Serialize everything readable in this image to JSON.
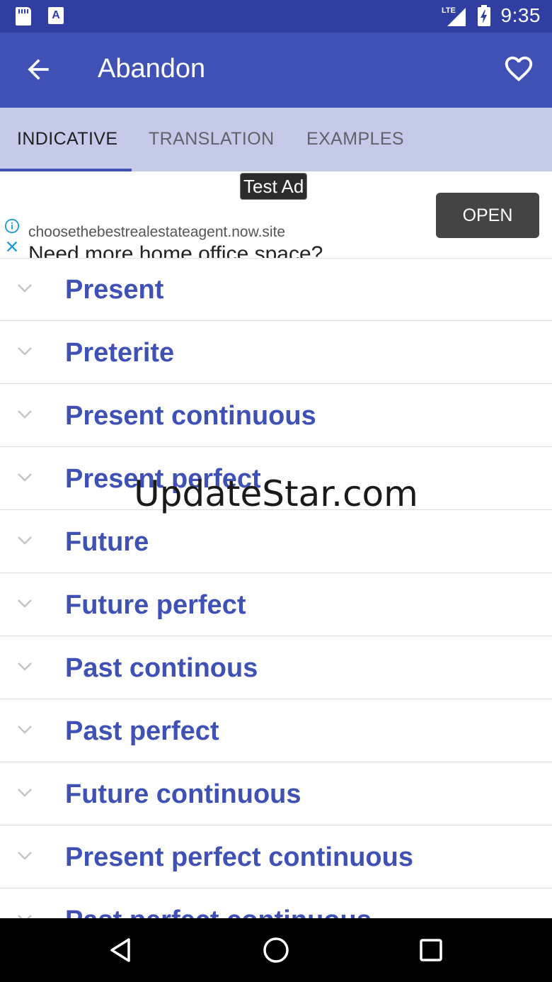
{
  "status_bar": {
    "time": "9:35",
    "network": "LTE",
    "icons": [
      "sd-card-icon",
      "app-a-icon",
      "lte-signal-icon",
      "battery-charging-icon"
    ],
    "app_icon_letter": "A"
  },
  "app_bar": {
    "title": "Abandon",
    "back_icon": "arrow-back-icon",
    "favorite_icon": "heart-outline-icon",
    "color": "#3f51b5"
  },
  "tabs": [
    {
      "label": "INDICATIVE",
      "active": true
    },
    {
      "label": "TRANSLATION",
      "active": false
    },
    {
      "label": "EXAMPLES",
      "active": false
    }
  ],
  "ad": {
    "badge": "Test Ad",
    "domain": "choosethebestrealestateagent.now.site",
    "headline": "Need more home office space?",
    "button": "OPEN"
  },
  "tenses": [
    "Present",
    "Preterite",
    "Present continuous",
    "Present perfect",
    "Future",
    "Future perfect",
    "Past continous",
    "Past perfect",
    "Future continuous",
    "Present perfect continuous",
    "Past perfect continuous"
  ],
  "watermark": "UpdateStar.com",
  "nav_bar": {
    "icons": [
      "back-triangle-icon",
      "home-circle-icon",
      "recents-square-icon"
    ]
  }
}
